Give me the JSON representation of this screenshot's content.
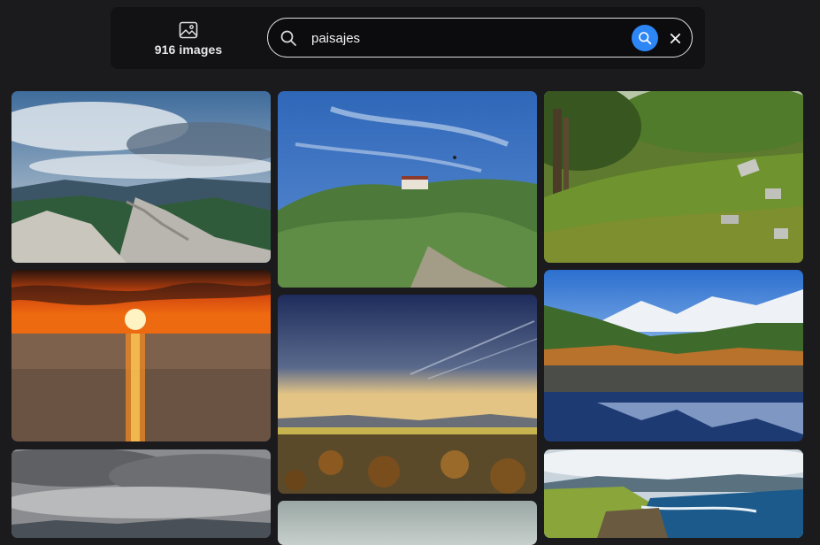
{
  "header": {
    "image_count_label": "916 images"
  },
  "search": {
    "value": "paisajes",
    "placeholder": ""
  },
  "icons": {
    "gallery": "images-icon",
    "search": "search-icon",
    "submit": "search-submit-icon",
    "clear": "close-icon"
  },
  "colors": {
    "accent": "#2d86f6",
    "background": "#1b1b1e",
    "panel": "#121214"
  },
  "gallery": {
    "images": [
      "mountain-ridge-clouds",
      "hillside-house-blue-sky",
      "mossy-forest-slope",
      "sunset-over-sea",
      "plains-at-dusk",
      "snowy-mountains-lake-reflection",
      "cloudy-sky-mountains",
      "foggy-landscape",
      "coastal-cliffs"
    ]
  }
}
